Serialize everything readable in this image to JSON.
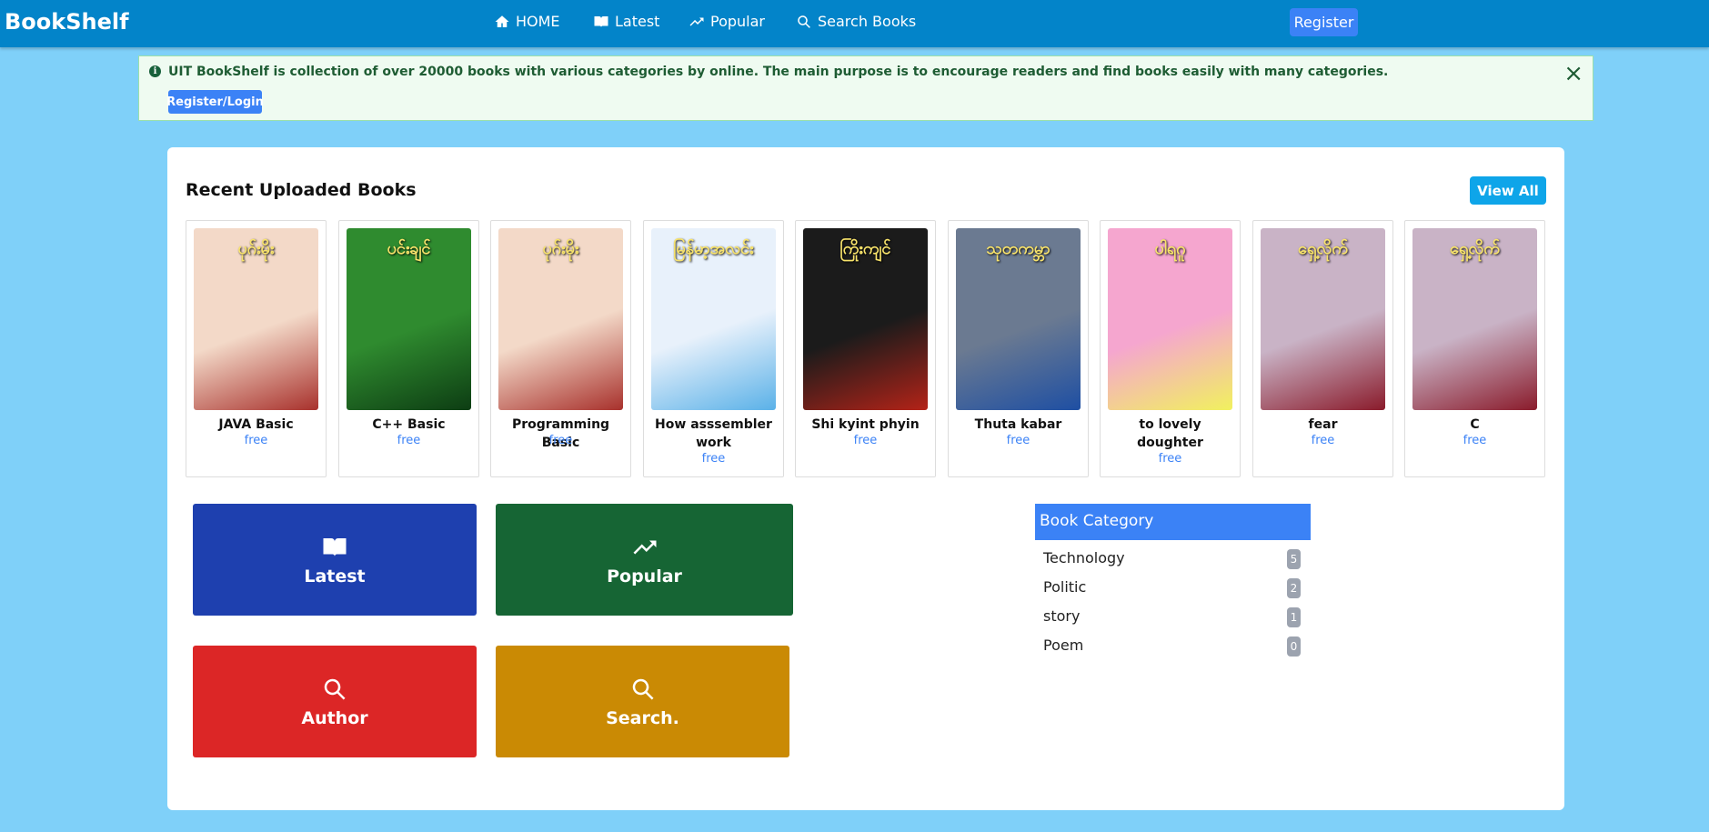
{
  "navbar": {
    "brand": "BookShelf",
    "items": [
      {
        "label": "HOME",
        "icon": "home-icon"
      },
      {
        "label": "Latest",
        "icon": "book-open-icon"
      },
      {
        "label": "Popular",
        "icon": "trending-up-icon"
      },
      {
        "label": "Search Books",
        "icon": "search-icon"
      }
    ],
    "register_label": "Register"
  },
  "alert": {
    "text": "UIT BookShelf is collection of over 20000 books with various categories by online. The main purpose is to encourage readers and find books easily with many categories.",
    "button_label": "Register/Login",
    "close_symbol": "×",
    "info_icon": "info-icon"
  },
  "recent": {
    "title": "Recent Uploaded Books",
    "view_all_label": "View All",
    "books": [
      {
        "title": "JAVA Basic",
        "price": "free",
        "cover_text": "ပုဂ်းမိုး",
        "cover_bg": "#f3d9c8",
        "accent": "#a8312c"
      },
      {
        "title": "C++ Basic",
        "price": "free",
        "cover_text": "ပင်းချင်",
        "cover_bg": "#2f8b2f",
        "accent": "#0d3d13"
      },
      {
        "title": "Programming Basic",
        "price": "free",
        "cover_text": "ပုဂ်းမိုး",
        "cover_bg": "#f3d9c8",
        "accent": "#a8312c"
      },
      {
        "title": "How asssembler work",
        "price": "free",
        "cover_text": "မြန်မာ့အလင်း",
        "cover_bg": "#e8f1fb",
        "accent": "#5ab1e8"
      },
      {
        "title": "Shi kyint phyin",
        "price": "free",
        "cover_text": "ကြိုးကျင်",
        "cover_bg": "#1b1b1b",
        "accent": "#b42318"
      },
      {
        "title": "Thuta kabar",
        "price": "free",
        "cover_text": "သုတကမ္ဘာ",
        "cover_bg": "#6b7a91",
        "accent": "#1e4fa3"
      },
      {
        "title": "to lovely doughter",
        "price": "free",
        "cover_text": "ပါရဂူ",
        "cover_bg": "#f5a6cf",
        "accent": "#f1f15e"
      },
      {
        "title": "fear",
        "price": "free",
        "cover_text": "ရှေ့လိုက်",
        "cover_bg": "#c9b3c6",
        "accent": "#8a1b2b"
      },
      {
        "title": "C",
        "price": "free",
        "cover_text": "ရှေ့လိုက်",
        "cover_bg": "#c9b3c6",
        "accent": "#8a1b2b"
      }
    ]
  },
  "tiles": [
    {
      "label": "Latest",
      "icon": "book-open-icon",
      "color": "#1e40af"
    },
    {
      "label": "Popular",
      "icon": "trending-up-icon",
      "color": "#166534"
    },
    {
      "label": "Author",
      "icon": "search-icon",
      "color": "#dc2626"
    },
    {
      "label": "Search.",
      "icon": "search-icon",
      "color": "#ca8a04"
    }
  ],
  "category": {
    "header": "Book Category",
    "items": [
      {
        "name": "Technology",
        "count": "5"
      },
      {
        "name": "Politic",
        "count": "2"
      },
      {
        "name": "story",
        "count": "1"
      },
      {
        "name": "Poem",
        "count": "0"
      }
    ]
  }
}
